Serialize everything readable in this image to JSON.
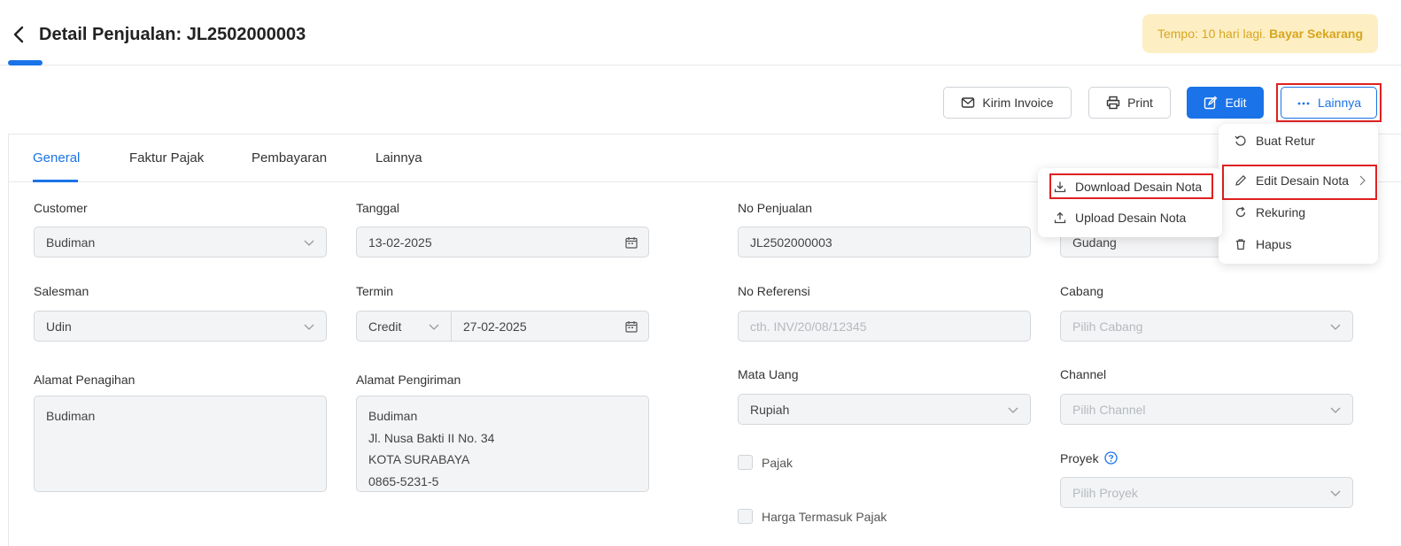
{
  "header": {
    "title": "Detail Penjualan: JL2502000003",
    "due_text": "Tempo: 10 hari lagi.",
    "pay_now": "Bayar Sekarang"
  },
  "toolbar": {
    "send_invoice": "Kirim Invoice",
    "print": "Print",
    "edit": "Edit",
    "more": "Lainnya"
  },
  "tabs": [
    "General",
    "Faktur Pajak",
    "Pembayaran",
    "Lainnya"
  ],
  "form": {
    "customer_label": "Customer",
    "customer_value": "Budiman",
    "date_label": "Tanggal",
    "date_value": "13-02-2025",
    "sales_no_label": "No Penjualan",
    "sales_no_value": "JL2502000003",
    "warehouse_value": "Gudang",
    "salesman_label": "Salesman",
    "salesman_value": "Udin",
    "term_label": "Termin",
    "term_type": "Credit",
    "term_date": "27-02-2025",
    "reference_label": "No Referensi",
    "reference_placeholder": "cth. INV/20/08/12345",
    "branch_label": "Cabang",
    "branch_placeholder": "Pilih Cabang",
    "billing_label": "Alamat Penagihan",
    "billing_value": "Budiman",
    "shipping_label": "Alamat Pengiriman",
    "shipping_lines": [
      "Budiman",
      "Jl. Nusa Bakti II No. 34",
      "KOTA SURABAYA",
      "0865-5231-5"
    ],
    "currency_label": "Mata Uang",
    "currency_value": "Rupiah",
    "channel_label": "Channel",
    "channel_placeholder": "Pilih Channel",
    "tax_checkbox": "Pajak",
    "tax_included_checkbox": "Harga Termasuk Pajak",
    "project_label": "Proyek",
    "project_placeholder": "Pilih Proyek"
  },
  "more_menu": {
    "items": [
      "Buat Retur",
      "Edit Desain Nota",
      "Rekuring",
      "Hapus"
    ]
  },
  "submenu": {
    "items": [
      "Download Desain Nota",
      "Upload Desain Nota"
    ]
  },
  "colors": {
    "primary": "#1a73e8",
    "highlight": "#e02020",
    "banner_bg": "#fdefc3",
    "banner_text": "#d9a520"
  }
}
